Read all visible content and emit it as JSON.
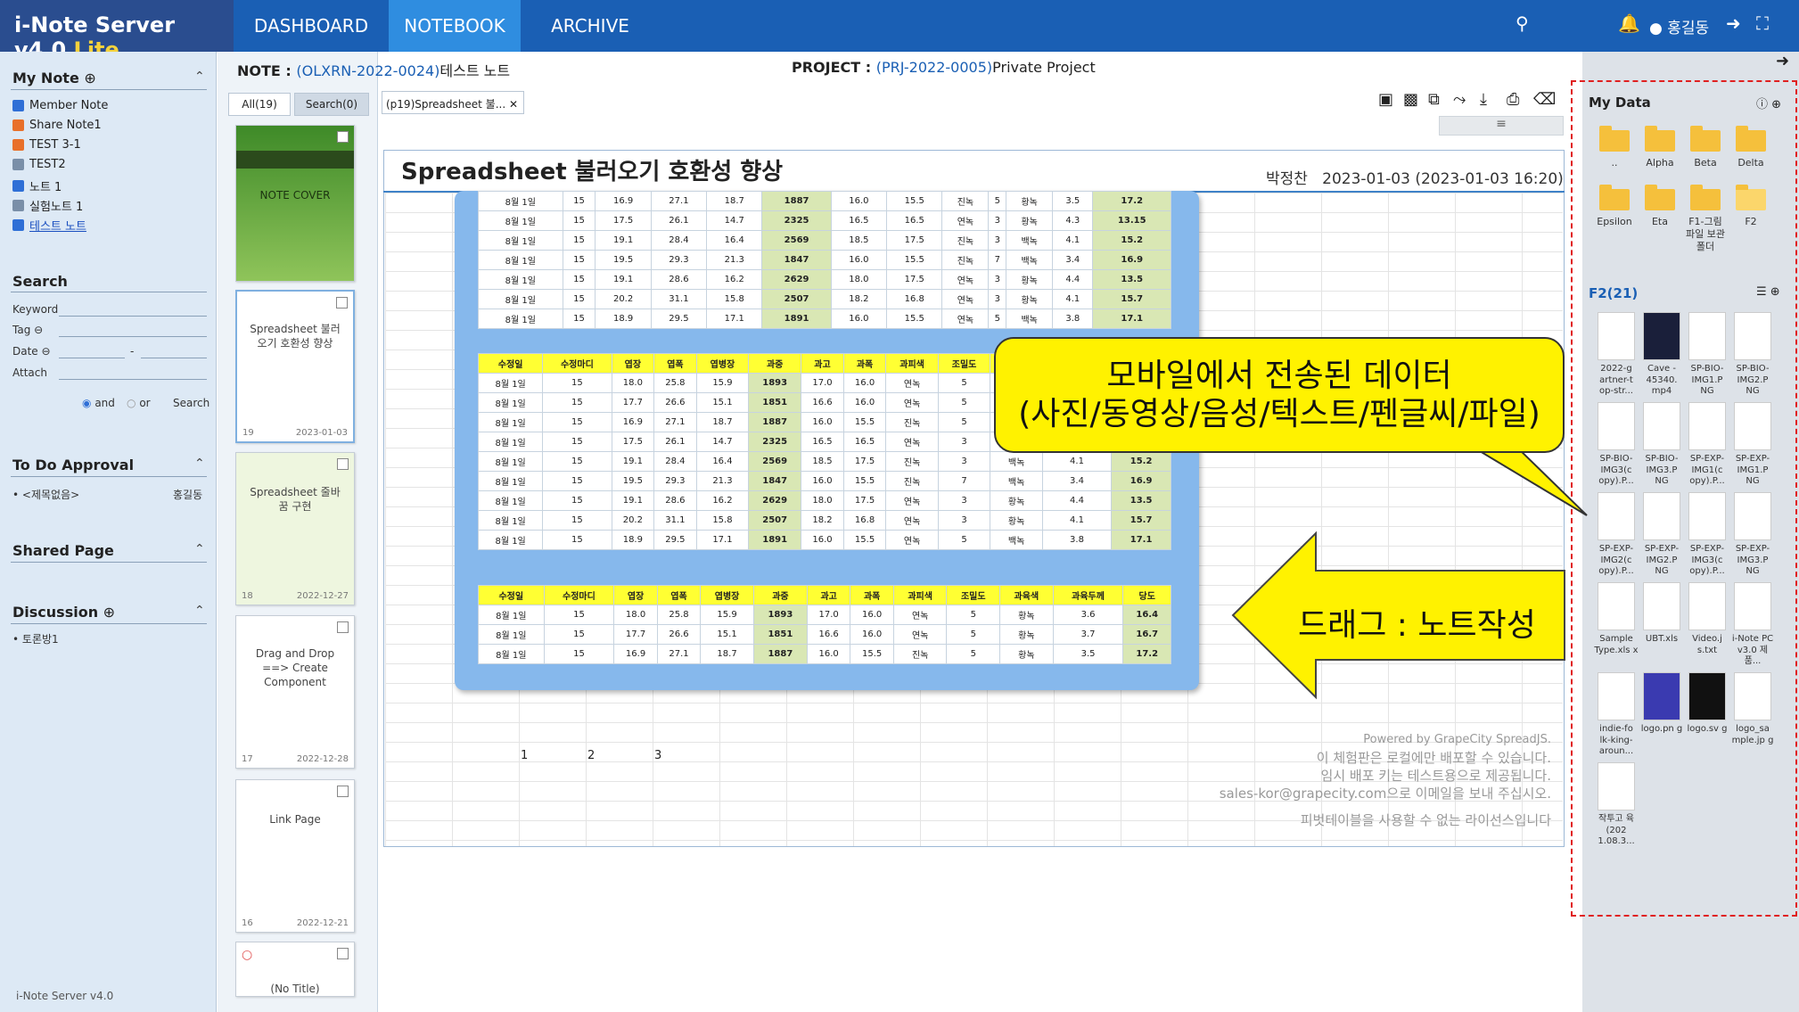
{
  "header": {
    "brand_main": "i-Note Server v4.0",
    "brand_lite": "Lite",
    "tabs": [
      "DASHBOARD",
      "NOTEBOOK",
      "ARCHIVE"
    ],
    "active_tab": "NOTEBOOK",
    "user": "홍길동"
  },
  "left": {
    "my_note_title": "My Note",
    "notes": [
      {
        "label": "Member Note",
        "color": "#2f6fd6"
      },
      {
        "label": "Share Note1",
        "color": "#e8702a"
      },
      {
        "label": "TEST 3-1",
        "color": "#e8702a"
      },
      {
        "label": "TEST2",
        "color": "#7a8fa8"
      },
      {
        "label": "노트 1",
        "color": "#2f6fd6"
      },
      {
        "label": "실험노트 1",
        "color": "#7a8fa8"
      },
      {
        "label": "테스트 노트",
        "color": "#2f6fd6"
      }
    ],
    "search_title": "Search",
    "keyword_label": "Keyword",
    "tag_label": "Tag",
    "date_label": "Date",
    "attach_label": "Attach",
    "and_label": "and",
    "or_label": "or",
    "search_label": "Search",
    "todo_title": "To Do Approval",
    "todo_item": "<제목없음>",
    "todo_user": "홍길동",
    "shared_title": "Shared Page",
    "discussion_title": "Discussion",
    "discussion_item": "토론방1",
    "footer": "i-Note Server v4.0"
  },
  "thumbs": {
    "tab_all": "All(19)",
    "tab_search": "Search(0)",
    "cover_label": "NOTE COVER",
    "items": [
      {
        "title": "Spreadsheet 불러오기 호환성 향상",
        "num": "19",
        "date": "2023-01-03"
      },
      {
        "title": "Spreadsheet 줄바꿈 구현",
        "num": "18",
        "date": "2022-12-27"
      },
      {
        "title": "Drag and Drop ==> Create Component",
        "num": "17",
        "date": "2022-12-28"
      },
      {
        "title": "Link Page",
        "num": "16",
        "date": "2022-12-21"
      },
      {
        "title": "(No Title)",
        "num": "",
        "date": ""
      }
    ]
  },
  "main": {
    "note_label": "NOTE :",
    "note_code": "(OLXRN-2022-0024)",
    "note_name": "테스트 노트",
    "project_label": "PROJECT :",
    "project_code": "(PRJ-2022-0005)",
    "project_name": "Private Project",
    "doc_tab": "(p19)Spreadsheet 불...",
    "page_title": "Spreadsheet 불러오기 호환성 향상",
    "author": "박정찬",
    "date": "2023-01-03 (2023-01-03 16:20)",
    "cell_numbers": [
      "1",
      "2",
      "3"
    ],
    "watermark": [
      "Powered by GrapeCity SpreadJS.",
      "이 체험판은 로컬에만 배포할 수 있습니다.",
      "임시 배포 키는 테스트용으로 제공됩니다.",
      "sales-kor@grapecity.com으로 이메일을 보내 주십시오.",
      "피벗테이블을 사용할 수 없는 라이선스입니다"
    ]
  },
  "sheet": {
    "headers": [
      "수정일",
      "수정마디",
      "엽장",
      "엽폭",
      "엽병장",
      "과중",
      "과고",
      "과폭",
      "과피색",
      "조밀도",
      "과육색",
      "과육두께",
      "당도"
    ],
    "rows": [
      [
        "8월 1일",
        "15",
        "18.0",
        "25.8",
        "15.9",
        "1893",
        "17.0",
        "16.0",
        "연녹",
        "5",
        "황녹",
        "3.6",
        "16.4"
      ],
      [
        "8월 1일",
        "15",
        "17.7",
        "26.6",
        "15.1",
        "1851",
        "16.6",
        "16.0",
        "연녹",
        "5",
        "황녹",
        "3.7",
        "16.7"
      ],
      [
        "8월 1일",
        "15",
        "16.9",
        "27.1",
        "18.7",
        "1887",
        "16.0",
        "15.5",
        "진녹",
        "5",
        "황녹",
        "3.5",
        "17.2"
      ],
      [
        "8월 1일",
        "15",
        "17.5",
        "26.1",
        "14.7",
        "2325",
        "16.5",
        "16.5",
        "연녹",
        "3",
        "황녹",
        "4.3",
        "13.15"
      ],
      [
        "8월 1일",
        "15",
        "19.1",
        "28.4",
        "16.4",
        "2569",
        "18.5",
        "17.5",
        "진녹",
        "3",
        "백녹",
        "4.1",
        "15.2"
      ],
      [
        "8월 1일",
        "15",
        "19.5",
        "29.3",
        "21.3",
        "1847",
        "16.0",
        "15.5",
        "진녹",
        "7",
        "백녹",
        "3.4",
        "16.9"
      ],
      [
        "8월 1일",
        "15",
        "19.1",
        "28.6",
        "16.2",
        "2629",
        "18.0",
        "17.5",
        "연녹",
        "3",
        "황녹",
        "4.4",
        "13.5"
      ],
      [
        "8월 1일",
        "15",
        "20.2",
        "31.1",
        "15.8",
        "2507",
        "18.2",
        "16.8",
        "연녹",
        "3",
        "황녹",
        "4.1",
        "15.7"
      ],
      [
        "8월 1일",
        "15",
        "18.9",
        "29.5",
        "17.1",
        "1891",
        "16.0",
        "15.5",
        "연녹",
        "5",
        "백녹",
        "3.8",
        "17.1"
      ]
    ]
  },
  "right": {
    "mydata_title": "My Data",
    "folders": [
      "..",
      "Alpha",
      "Beta",
      "Delta",
      "Epsilon",
      "Eta",
      "F1-그림 파일 보관 폴더",
      "F2"
    ],
    "f2_title": "F2(21)",
    "files": [
      "2022-g artner-t op-str...",
      "Cave - 45340. mp4",
      "SP-BIO-IMG1.P NG",
      "SP-BIO-IMG2.P NG",
      "SP-BIO-IMG3(c opy).P...",
      "SP-BIO-IMG3.P NG",
      "SP-EXP-IMG1(c opy).P...",
      "SP-EXP-IMG1.P NG",
      "SP-EXP-IMG2(c opy).P...",
      "SP-EXP-IMG2.P NG",
      "SP-EXP-IMG3(c opy).P...",
      "SP-EXP-IMG3.P NG",
      "Sample Type.xls x",
      "UBT.xls",
      "Video.j s.txt",
      "i-Note PC v3.0 제품...",
      "indie-fo lk-king-aroun...",
      "logo.pn g",
      "logo.sv g",
      "logo_sa mple.jp g",
      "작투고 육(202 1.08.3..."
    ]
  },
  "annotations": {
    "callout_line1": "모바일에서 전송된 데이터",
    "callout_line2": "(사진/동영상/음성/텍스트/펜글씨/파일)",
    "drag_label": "드래그 : 노트작성"
  },
  "colors": {
    "topbar": "#1a5fb4",
    "accent": "#2f8de0",
    "callout": "#fff200"
  }
}
